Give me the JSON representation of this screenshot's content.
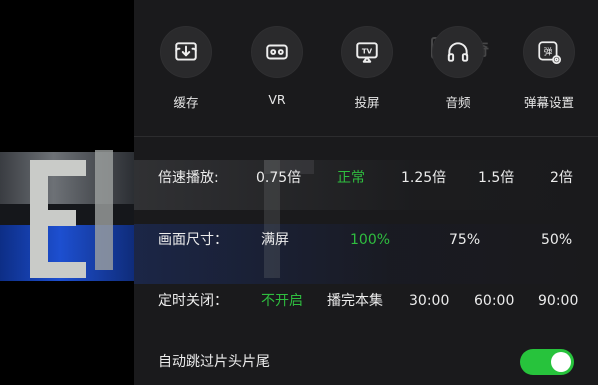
{
  "quick_actions": [
    {
      "label": "缓存",
      "icon": "download-icon"
    },
    {
      "label": "VR",
      "icon": "vr-goggles-icon"
    },
    {
      "label": "投屏",
      "icon": "tv-cast-icon"
    },
    {
      "label": "音频",
      "icon": "headphones-icon"
    },
    {
      "label": "弹幕设置",
      "icon": "danmaku-settings-icon"
    }
  ],
  "danmaku_glyph": "弹",
  "tv_glyph": "TV",
  "watermark": {
    "text": "爱奇"
  },
  "speed": {
    "label": "倍速播放:",
    "options": [
      "0.75倍",
      "正常",
      "1.25倍",
      "1.5倍",
      "2倍"
    ],
    "selected": "正常"
  },
  "size": {
    "label": "画面尺寸：",
    "options": [
      "满屏",
      "100%",
      "75%",
      "50%"
    ],
    "selected": "100%"
  },
  "timer": {
    "label": "定时关闭：",
    "options": [
      "不开启",
      "播完本集",
      "30:00",
      "60:00",
      "90:00"
    ],
    "selected": "不开启"
  },
  "skip": {
    "label": "自动跳过片头片尾",
    "enabled": true
  },
  "colors": {
    "accent": "#2fbd3f",
    "toggle_on": "#27c33c",
    "panel_bg": "#1a1a1c"
  }
}
